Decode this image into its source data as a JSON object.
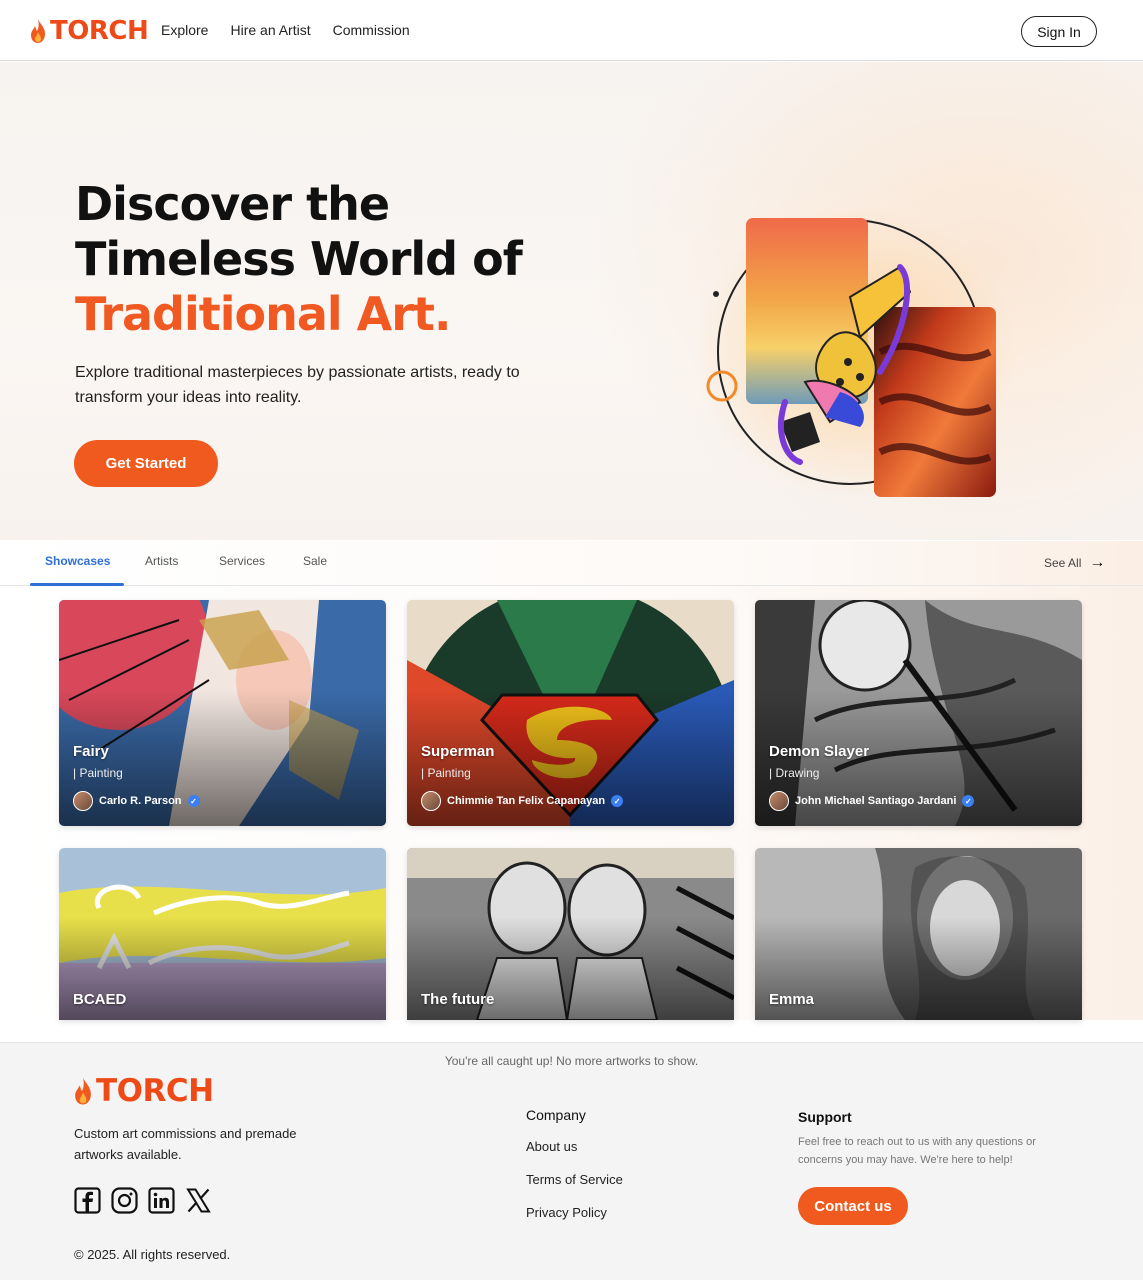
{
  "brand": {
    "name": "TORCH",
    "accent_color": "#f05a1f"
  },
  "nav": {
    "links": [
      "Explore",
      "Hire an Artist",
      "Commission"
    ],
    "sign_in_label": "Sign In"
  },
  "hero": {
    "title_line1": "Discover the",
    "title_line2": "Timeless World of",
    "title_accent": "Traditional Art.",
    "subtitle": "Explore traditional masterpieces by passionate artists, ready to transform your ideas into reality.",
    "cta_label": "Get Started"
  },
  "tabs": {
    "items": [
      "Showcases",
      "Artists",
      "Services",
      "Sale"
    ],
    "active": "Showcases",
    "see_all_label": "See All",
    "active_color": "#2f6fd6"
  },
  "artworks": [
    {
      "title": "Fairy",
      "category": "| Painting",
      "artist": "Carlo R. Parson",
      "verified": true
    },
    {
      "title": "Superman",
      "category": "| Painting",
      "artist": "Chimmie Tan Felix Capanayan",
      "verified": true
    },
    {
      "title": "Demon Slayer",
      "category": "| Drawing",
      "artist": "John Michael Santiago Jardani",
      "verified": true
    },
    {
      "title": "BCAED",
      "category": "",
      "artist": ""
    },
    {
      "title": "The future",
      "category": "",
      "artist": ""
    },
    {
      "title": "Emma",
      "category": "",
      "artist": ""
    }
  ],
  "footer": {
    "end_message": "You're all caught up! No more artworks to show.",
    "tagline": "Custom art commissions and premade artworks available.",
    "socials": [
      "facebook-icon",
      "instagram-icon",
      "linkedin-icon",
      "x-icon"
    ],
    "copyright": "© 2025. All rights reserved.",
    "company": {
      "heading": "Company",
      "links": [
        "About us",
        "Terms of Service",
        "Privacy Policy"
      ]
    },
    "support": {
      "heading": "Support",
      "description": "Feel free to reach out to us with any questions or concerns you may have. We're here to help!",
      "contact_label": "Contact us"
    }
  }
}
